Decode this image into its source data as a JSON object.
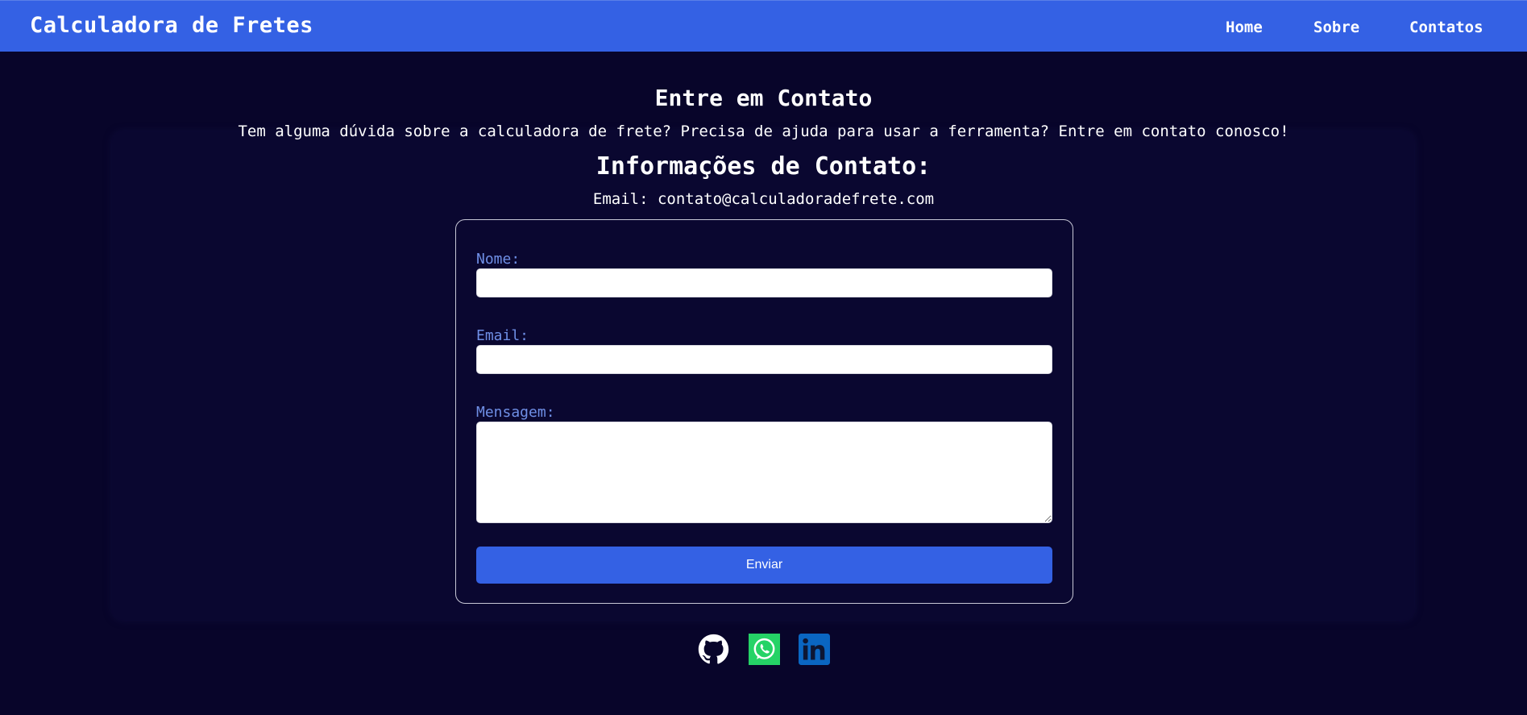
{
  "header": {
    "brand": "Calculadora de Fretes",
    "nav": [
      {
        "label": "Home"
      },
      {
        "label": "Sobre"
      },
      {
        "label": "Contatos"
      }
    ],
    "background_color": "#3461e4"
  },
  "main": {
    "title": "Entre em Contato",
    "subtitle": "Tem alguma dúvida sobre a calculadora de frete? Precisa de ajuda para usar a ferramenta? Entre em contato conosco!",
    "info_heading": "Informações de Contato:",
    "info_email": "Email: contato@calculadoradefrete.com"
  },
  "form": {
    "nome_label": "Nome:",
    "nome_value": "",
    "email_label": "Email:",
    "email_value": "",
    "mensagem_label": "Mensagem:",
    "mensagem_value": "",
    "submit_label": "Enviar",
    "label_color": "#6f8fe6"
  },
  "social": [
    {
      "icon": "github-icon"
    },
    {
      "icon": "whatsapp-icon"
    },
    {
      "icon": "linkedin-icon"
    }
  ],
  "colors": {
    "page_background": "#08052a",
    "accent": "#3461e4",
    "whatsapp": "#25d366",
    "linkedin": "#0a66c2"
  }
}
